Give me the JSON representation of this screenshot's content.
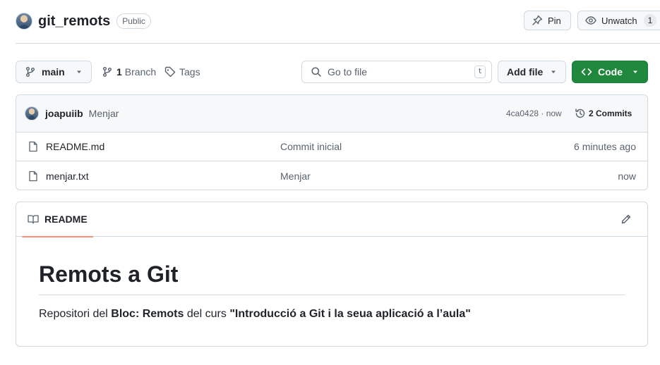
{
  "repo": {
    "name": "git_remots",
    "visibility": "Public"
  },
  "header_actions": {
    "pin_label": "Pin",
    "watch_label": "Unwatch",
    "watch_count": "1"
  },
  "toolbar": {
    "branch": "main",
    "branches_count": "1",
    "branches_label": "Branch",
    "tags_label": "Tags",
    "go_to_file_placeholder": "Go to file",
    "go_to_file_shortcut": "t",
    "add_file_label": "Add file",
    "code_label": "Code"
  },
  "latest_commit": {
    "author": "joapuiib",
    "message": "Menjar",
    "sha_time": "4ca0428 · now",
    "commits_label": "2 Commits"
  },
  "files": [
    {
      "name": "README.md",
      "commit_message": "Commit inicial",
      "time": "6 minutes ago"
    },
    {
      "name": "menjar.txt",
      "commit_message": "Menjar",
      "time": "now"
    }
  ],
  "readme": {
    "tab_label": "README",
    "title": "Remots a Git",
    "para_1": "Repositori del ",
    "para_bold_1": "Bloc: Remots",
    "para_2": " del curs ",
    "para_bold_2": "\"Introducció a Git i la seua aplicació a l’aula\""
  },
  "colors": {
    "primary_button": "#1f883d",
    "tab_underline": "#fd8c73",
    "border": "#d1d9e0",
    "muted_text": "#59636e"
  }
}
